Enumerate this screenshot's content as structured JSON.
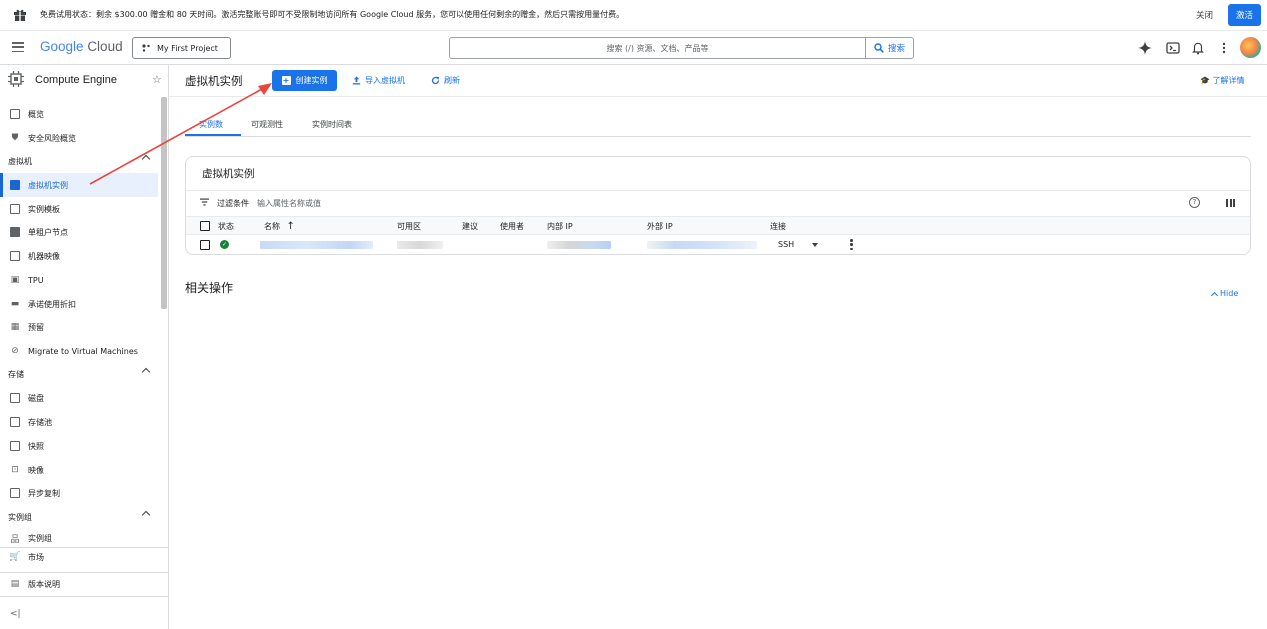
{
  "banner": {
    "message": "免费试用状态：剩余 $300.00 赠金和 80 天时间。激活完整账号即可不受限制地访问所有 Google Cloud 服务，您可以使用任何剩余的赠金，然后只需按用量付费。",
    "close_label": "关闭",
    "activate_label": "激活"
  },
  "header": {
    "logo_google": "Google",
    "logo_cloud": "Cloud",
    "project_name": "My First Project",
    "search_placeholder": "搜索 (/) 资源、文档、产品等",
    "search_button": "搜索"
  },
  "sidebar": {
    "product_title": "Compute Engine",
    "items_top": [
      {
        "label": "概览"
      },
      {
        "label": "安全风险概览"
      }
    ],
    "section_vm": "虚拟机",
    "items_vm": [
      {
        "label": "虚拟机实例"
      },
      {
        "label": "实例模板"
      },
      {
        "label": "单租户节点"
      },
      {
        "label": "机器映像"
      },
      {
        "label": "TPU"
      },
      {
        "label": "承诺使用折扣"
      },
      {
        "label": "预留"
      },
      {
        "label": "Migrate to Virtual Machines"
      }
    ],
    "section_storage": "存储",
    "items_storage": [
      {
        "label": "磁盘"
      },
      {
        "label": "存储池"
      },
      {
        "label": "快照"
      },
      {
        "label": "映像"
      },
      {
        "label": "异步复制"
      }
    ],
    "section_instance_groups": "实例组",
    "items_groups": [
      {
        "label": "实例组"
      }
    ],
    "marketplace": "市场",
    "release_notes": "版本说明",
    "collapse": "<|"
  },
  "toolbar": {
    "page_title": "虚拟机实例",
    "create_label": "创建实例",
    "import_label": "导入虚拟机",
    "refresh_label": "刷新",
    "learn_label": "了解详情"
  },
  "tabs": [
    {
      "label": "实例数"
    },
    {
      "label": "可观测性"
    },
    {
      "label": "实例时间表"
    }
  ],
  "card": {
    "title": "虚拟机实例",
    "filter_label": "过滤条件",
    "filter_placeholder": "输入属性名称或值",
    "columns": [
      "状态",
      "名称",
      "可用区",
      "建议",
      "使用者",
      "内部 IP",
      "外部 IP",
      "连接"
    ],
    "sort_arrow": "↑",
    "row": {
      "connect": "SSH"
    }
  },
  "related": {
    "title": "相关操作",
    "hide_label": "Hide"
  },
  "colors": {
    "primary": "#1a73e8",
    "annotation_arrow": "#e8453c",
    "status_ok": "#188038"
  }
}
